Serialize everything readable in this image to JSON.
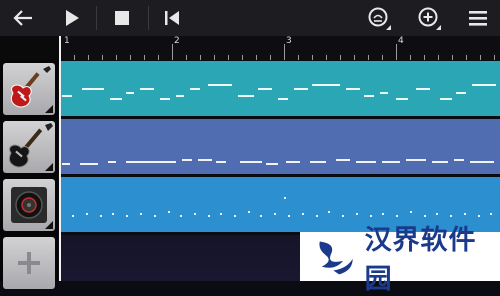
{
  "toolbar": {
    "icons": [
      "back-arrow-icon",
      "play-icon",
      "stop-icon",
      "skip-to-start-icon",
      "tempo-icon",
      "add-track-icon",
      "menu-icon"
    ]
  },
  "ruler": {
    "labels": [
      "1",
      "2",
      "3",
      "4"
    ]
  },
  "tracks": [
    {
      "name": "electric-guitar",
      "color": "#2aa6b4"
    },
    {
      "name": "bass-guitar",
      "color": "#4f6db0"
    },
    {
      "name": "drum-machine",
      "color": "#2c8fd0"
    }
  ],
  "add_track_symbol": "+",
  "watermark": {
    "text": "汉界软件园"
  },
  "colors": {
    "toolbar": "#1d1d21",
    "guitar_lane": "#2aa6b4",
    "bass_lane": "#4f6db0",
    "drum_lane": "#2c8fd0",
    "empty_lane": "#151326"
  }
}
